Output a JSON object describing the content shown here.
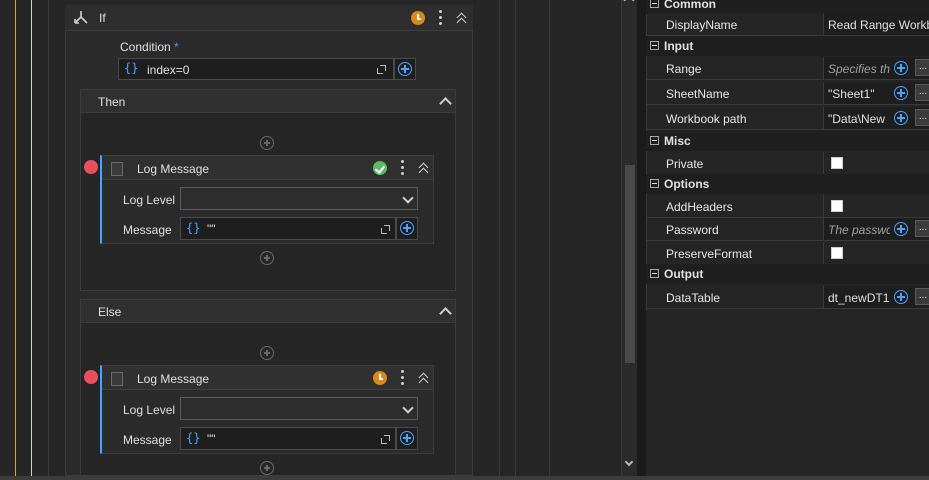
{
  "designer": {
    "if_block": {
      "title": "If",
      "condition_label": "Condition",
      "required_mark": "*",
      "condition_value": "index=0",
      "then_label": "Then",
      "else_label": "Else"
    },
    "then_activity": {
      "title": "Log Message",
      "log_level_label": "Log Level",
      "log_level_value": "",
      "message_label": "Message",
      "message_value": "\"\""
    },
    "else_activity": {
      "title": "Log Message",
      "log_level_label": "Log Level",
      "log_level_value": "",
      "message_label": "Message",
      "message_value": "\"\""
    },
    "expr_icon": "{}"
  },
  "properties": {
    "categories": {
      "common": "Common",
      "input": "Input",
      "misc": "Misc",
      "options": "Options",
      "output": "Output"
    },
    "display_name": {
      "label": "DisplayName",
      "value": "Read Range Workbook"
    },
    "range": {
      "label": "Range",
      "placeholder": "Specifies th"
    },
    "sheet_name": {
      "label": "SheetName",
      "value": "\"Sheet1\""
    },
    "workbook_path": {
      "label": "Workbook path",
      "value": "\"Data\\New"
    },
    "private": {
      "label": "Private",
      "checked": false
    },
    "add_headers": {
      "label": "AddHeaders",
      "checked": false
    },
    "password": {
      "label": "Password",
      "placeholder": "The passwc"
    },
    "preserve_format": {
      "label": "PreserveFormat",
      "checked": false
    },
    "data_table": {
      "label": "DataTable",
      "value": "dt_newDT1"
    },
    "ellipsis": "..."
  },
  "colors": {
    "accent_blue": "#4aa3ff",
    "warning_orange": "#d98a1a",
    "success_green": "#5dbb63",
    "breakpoint_red": "#e8505b",
    "guide_orange": "#e8a317"
  }
}
